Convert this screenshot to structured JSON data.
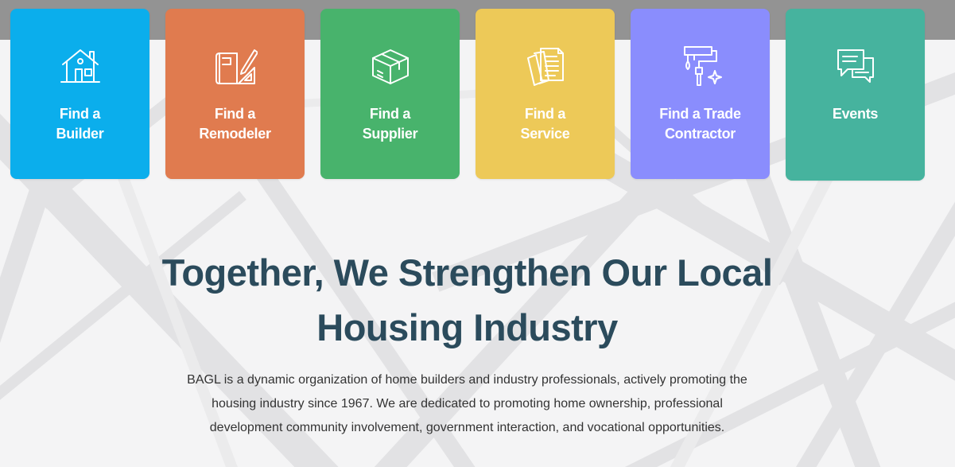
{
  "tiles": [
    {
      "line1": "Find a",
      "line2": "Builder",
      "icon": "house-icon",
      "color": "#0baeec"
    },
    {
      "line1": "Find a",
      "line2": "Remodeler",
      "icon": "blueprint-icon",
      "color": "#e07b4f"
    },
    {
      "line1": "Find a",
      "line2": "Supplier",
      "icon": "package-icon",
      "color": "#48b36c"
    },
    {
      "line1": "Find a",
      "line2": "Service",
      "icon": "documents-icon",
      "color": "#edc958"
    },
    {
      "line1": "Find a Trade",
      "line2": "Contractor",
      "icon": "paint-roller-icon",
      "color": "#8a8dfd"
    },
    {
      "line1": "Events",
      "line2": "",
      "icon": "chat-bubbles-icon",
      "color": "#46b39e"
    }
  ],
  "hero": {
    "heading_line1": "Together, We Strengthen Our Local",
    "heading_line2": "Housing Industry",
    "intro_line1": "BAGL is a dynamic organization of home builders and industry professionals, actively promoting the",
    "intro_line2": "housing industry since 1967. We are dedicated to promoting home ownership, professional",
    "intro_line3": "development community involvement, government interaction, and vocational opportunities."
  },
  "colors": {
    "heading": "#2b4b5c",
    "body_text": "#333333",
    "top_strip": "#939393",
    "background": "#f4f4f5"
  }
}
